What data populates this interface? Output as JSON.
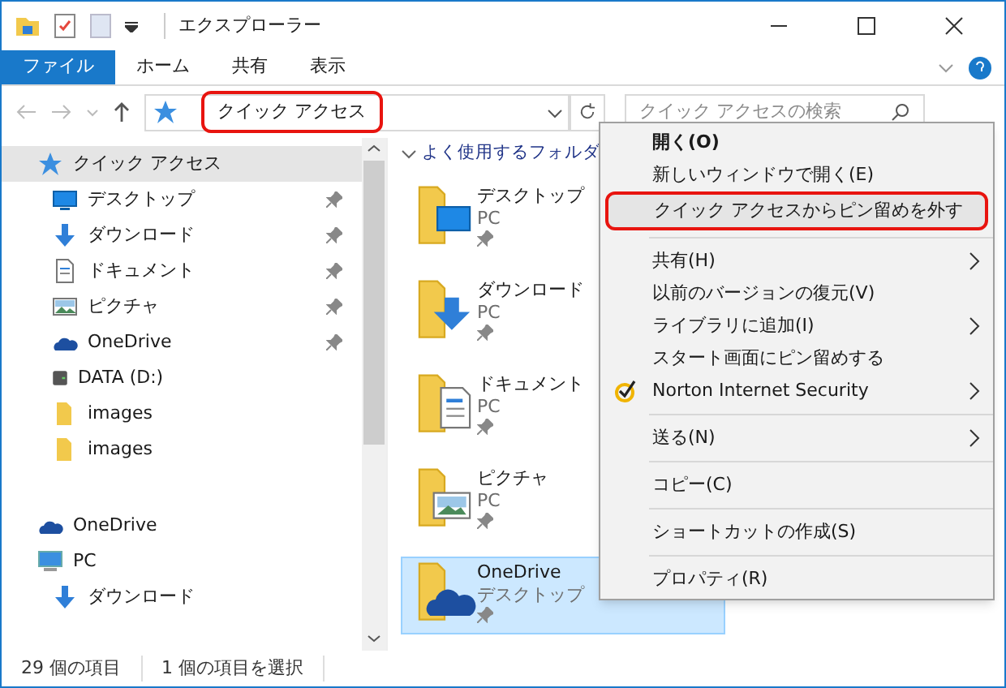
{
  "window": {
    "title": "エクスプローラー"
  },
  "ribbon_tabs": [
    {
      "label": "ファイル",
      "selected": true
    },
    {
      "label": "ホーム",
      "selected": false
    },
    {
      "label": "共有",
      "selected": false
    },
    {
      "label": "表示",
      "selected": false
    }
  ],
  "address": {
    "path": "クイック アクセス",
    "annotated": true
  },
  "search": {
    "placeholder": "クイック アクセスの検索"
  },
  "sidebar": {
    "items": [
      {
        "label": "クイック アクセス",
        "kind": "star",
        "selected": true,
        "children": [
          {
            "label": "デスクトップ",
            "kind": "desktop",
            "pinned": true,
            "selected": false
          },
          {
            "label": "ダウンロード",
            "kind": "download",
            "pinned": true,
            "selected": false
          },
          {
            "label": "ドキュメント",
            "kind": "document",
            "pinned": true,
            "selected": false
          },
          {
            "label": "ピクチャ",
            "kind": "picture",
            "pinned": true,
            "selected": false
          },
          {
            "label": "OneDrive",
            "kind": "cloud",
            "pinned": true,
            "selected": false
          },
          {
            "label": "DATA (D:)",
            "kind": "drive",
            "pinned": false,
            "selected": false
          },
          {
            "label": "images",
            "kind": "folder",
            "pinned": false,
            "selected": false
          },
          {
            "label": "images",
            "kind": "folder",
            "pinned": false,
            "selected": false
          }
        ]
      },
      {
        "label": "OneDrive",
        "kind": "cloud",
        "selected": false,
        "gap": true
      },
      {
        "label": "PC",
        "kind": "pc",
        "selected": false,
        "children": [
          {
            "label": "ダウンロード",
            "kind": "download",
            "pinned": false,
            "selected": false
          }
        ]
      }
    ]
  },
  "content": {
    "group": "よく使用するフォルダ",
    "tiles": [
      {
        "name": "デスクトップ",
        "location": "PC",
        "kind": "desktop",
        "selected": false
      },
      {
        "name": "ダウンロード",
        "location": "PC",
        "kind": "download",
        "selected": false
      },
      {
        "name": "ドキュメント",
        "location": "PC",
        "kind": "document",
        "selected": false
      },
      {
        "name": "ピクチャ",
        "location": "PC",
        "kind": "picture",
        "selected": false
      },
      {
        "name": "OneDrive",
        "location": "デスクトップ",
        "kind": "cloud",
        "selected": true
      }
    ]
  },
  "context_menu": {
    "groups": [
      [
        {
          "label": "開く(O)",
          "bold": true,
          "submenu": false,
          "kind": "plain",
          "annotated": false
        },
        {
          "label": "新しいウィンドウで開く(E)",
          "bold": false,
          "submenu": false,
          "kind": "plain",
          "annotated": false
        },
        {
          "label": "クイック アクセスからピン留めを外す",
          "bold": false,
          "submenu": false,
          "kind": "plain",
          "annotated": true
        }
      ],
      [
        {
          "label": "共有(H)",
          "bold": false,
          "submenu": true,
          "kind": "plain",
          "annotated": false
        },
        {
          "label": "以前のバージョンの復元(V)",
          "bold": false,
          "submenu": false,
          "kind": "plain",
          "annotated": false
        },
        {
          "label": "ライブラリに追加(I)",
          "bold": false,
          "submenu": true,
          "kind": "plain",
          "annotated": false
        },
        {
          "label": "スタート画面にピン留めする",
          "bold": false,
          "submenu": false,
          "kind": "plain",
          "annotated": false
        },
        {
          "label": "Norton Internet Security",
          "bold": false,
          "submenu": true,
          "kind": "norton",
          "annotated": false
        }
      ],
      [
        {
          "label": "送る(N)",
          "bold": false,
          "submenu": true,
          "kind": "plain",
          "annotated": false
        }
      ],
      [
        {
          "label": "コピー(C)",
          "bold": false,
          "submenu": false,
          "kind": "plain",
          "annotated": false
        }
      ],
      [
        {
          "label": "ショートカットの作成(S)",
          "bold": false,
          "submenu": false,
          "kind": "plain",
          "annotated": false
        }
      ],
      [
        {
          "label": "プロパティ(R)",
          "bold": false,
          "submenu": false,
          "kind": "plain",
          "annotated": false
        }
      ]
    ]
  },
  "status_bar": {
    "items": [
      "29 個の項目",
      "1 個の項目を選択"
    ]
  }
}
